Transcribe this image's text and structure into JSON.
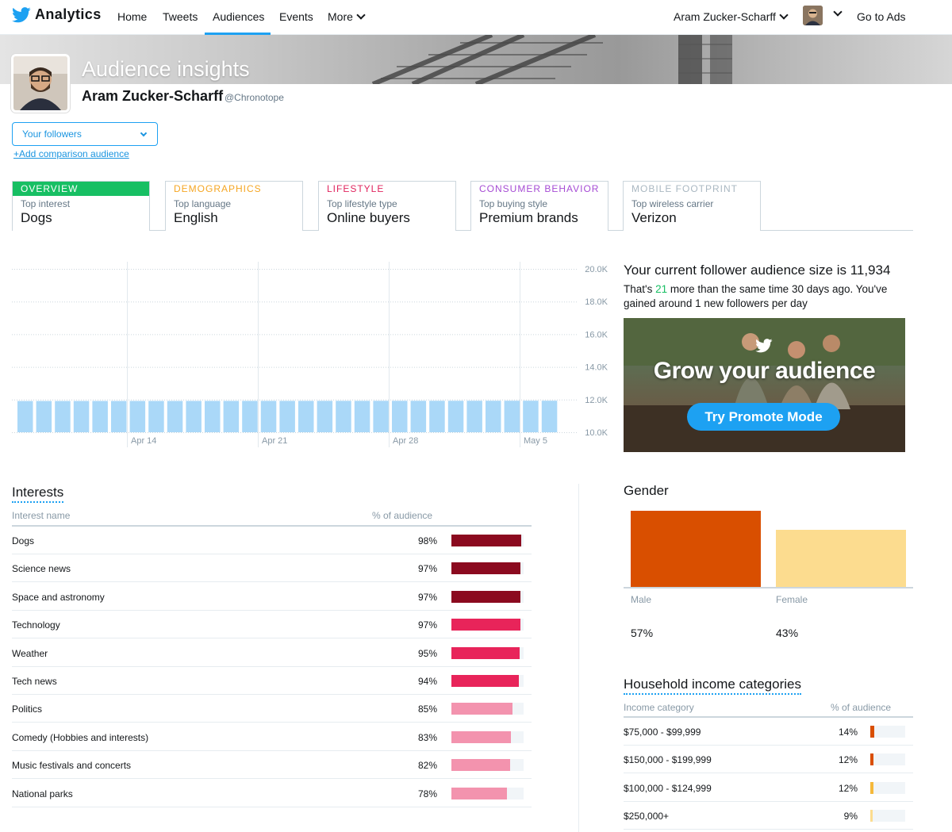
{
  "nav": {
    "brand": "Analytics",
    "links": [
      "Home",
      "Tweets",
      "Audiences",
      "Events",
      "More"
    ],
    "active": "Audiences",
    "user": "Aram Zucker-Scharff",
    "go_to_ads": "Go to Ads"
  },
  "header": {
    "title": "Audience insights",
    "name": "Aram Zucker-Scharff",
    "handle": "@Chronotope"
  },
  "audience": {
    "selected": "Your followers",
    "add_comparison": "+Add comparison audience"
  },
  "tabs": [
    {
      "label": "OVERVIEW",
      "sub": "Top interest",
      "value": "Dogs",
      "color": "#17bf63",
      "active": true
    },
    {
      "label": "DEMOGRAPHICS",
      "sub": "Top language",
      "value": "English",
      "color": "#f5a623",
      "active": false
    },
    {
      "label": "LIFESTYLE",
      "sub": "Top lifestyle type",
      "value": "Online buyers",
      "color": "#e0245e",
      "active": false
    },
    {
      "label": "CONSUMER BEHAVIOR",
      "sub": "Top buying style",
      "value": "Premium brands",
      "color": "#a64cd4",
      "active": false
    },
    {
      "label": "MOBILE FOOTPRINT",
      "sub": "Top wireless carrier",
      "value": "Verizon",
      "color": "#aab8c2",
      "active": false
    }
  ],
  "chart_data": {
    "type": "bar",
    "y_ticks": [
      "20.0K",
      "18.0K",
      "16.0K",
      "14.0K",
      "12.0K",
      "10.0K"
    ],
    "ylim": [
      10000,
      20000
    ],
    "x_ticks": [
      "Apr 14",
      "Apr 21",
      "Apr 28",
      "May 5"
    ],
    "values": [
      11913,
      11914,
      11914,
      11915,
      11916,
      11916,
      11917,
      11918,
      11918,
      11919,
      11920,
      11920,
      11921,
      11922,
      11922,
      11923,
      11924,
      11924,
      11925,
      11926,
      11926,
      11927,
      11928,
      11928,
      11929,
      11930,
      11931,
      11932,
      11932,
      11933,
      11934
    ],
    "bar_color": "#aad8f8",
    "grid": true
  },
  "summary": {
    "size_text": "Your current follower audience size is 11,934",
    "note_pre": "That's ",
    "note_num": "21",
    "note_post": " more than the same time 30 days ago. You've gained around 1 new followers per day"
  },
  "promo": {
    "title": "Grow your audience",
    "button": "Try Promote Mode"
  },
  "interests": {
    "title": "Interests",
    "col_name": "Interest name",
    "col_pct": "% of audience",
    "rows": [
      {
        "name": "Dogs",
        "pct": "98%",
        "value": 98,
        "color": "#8b0a1f"
      },
      {
        "name": "Science news",
        "pct": "97%",
        "value": 97,
        "color": "#8b0a1f"
      },
      {
        "name": "Space and astronomy",
        "pct": "97%",
        "value": 97,
        "color": "#8b0a1f"
      },
      {
        "name": "Technology",
        "pct": "97%",
        "value": 97,
        "color": "#e8245a"
      },
      {
        "name": "Weather",
        "pct": "95%",
        "value": 95,
        "color": "#e8245a"
      },
      {
        "name": "Tech news",
        "pct": "94%",
        "value": 94,
        "color": "#e8245a"
      },
      {
        "name": "Politics",
        "pct": "85%",
        "value": 85,
        "color": "#f393ae"
      },
      {
        "name": "Comedy (Hobbies and interests)",
        "pct": "83%",
        "value": 83,
        "color": "#f393ae"
      },
      {
        "name": "Music festivals and concerts",
        "pct": "82%",
        "value": 82,
        "color": "#f393ae"
      },
      {
        "name": "National parks",
        "pct": "78%",
        "value": 78,
        "color": "#f393ae"
      }
    ]
  },
  "gender": {
    "title": "Gender",
    "male_label": "Male",
    "female_label": "Female",
    "male_pct": "57%",
    "female_pct": "43%",
    "male_value": 57,
    "female_value": 43,
    "male_color": "#d94f00",
    "female_color": "#fcdc8f"
  },
  "income": {
    "title": "Household income categories",
    "col_name": "Income category",
    "col_pct": "% of audience",
    "rows": [
      {
        "name": "$75,000 - $99,999",
        "pct": "14%",
        "value": 14,
        "color": "#d94f00"
      },
      {
        "name": "$150,000 - $199,999",
        "pct": "12%",
        "value": 12,
        "color": "#d94f00"
      },
      {
        "name": "$100,000 - $124,999",
        "pct": "12%",
        "value": 12,
        "color": "#f5b93b"
      },
      {
        "name": "$250,000+",
        "pct": "9%",
        "value": 9,
        "color": "#fcdc8f"
      }
    ]
  }
}
